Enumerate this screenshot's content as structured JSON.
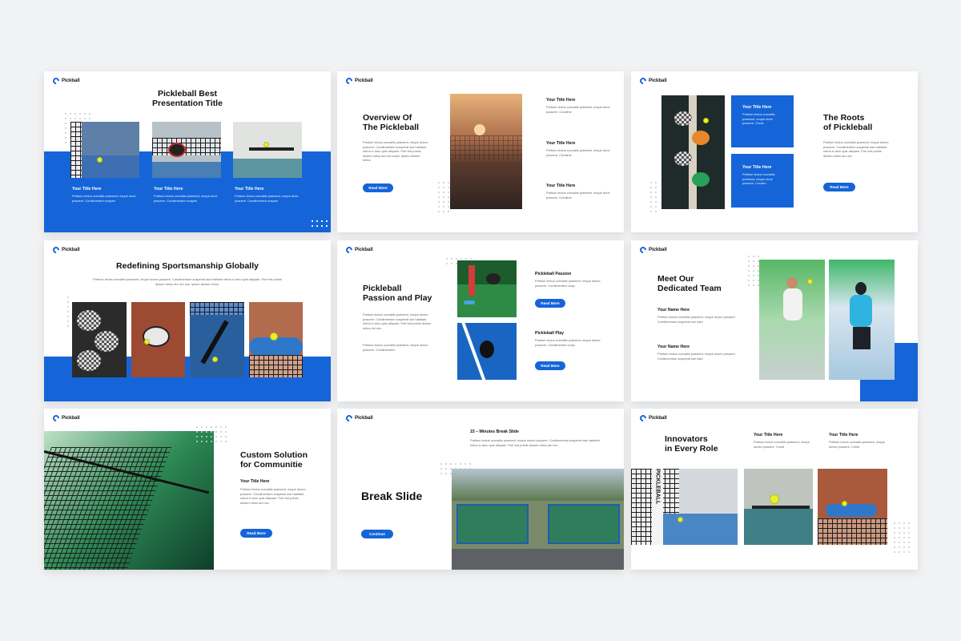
{
  "brand": "Pickball",
  "lorem": {
    "short": "Pretium lectus convallis praesent, neque donec posuere. Condimentum suspen",
    "medium": "Pretium lectus convallis praesent, neque donec posuere. Condimentum suspendi sse habitant netus in arcu quis aliquam.",
    "long": "Pretium lectus convallis praesent, neque donec posuere. Condimentum suspendi sse habitant netus in arcu quis aliquam. Port trot primis dictum netus dui nec sus. Ipsum dictum netus.",
    "tiny": "Pretium lectus convallis praesent, neque donec posuere. Condime"
  },
  "slide1": {
    "title_line1": "Pickleball Best",
    "title_line2": "Presentation Title",
    "items": [
      {
        "title": "Your Title Here",
        "text": "Pretium lectus convallis praesent, neque done posuere. Condimentum suspen"
      },
      {
        "title": "Your Title Here",
        "text": "Pretium lectus convallis praesent, neque done posuere. Condimentum suspen"
      },
      {
        "title": "Your Title Here",
        "text": "Pretium lectus convallis praesent, neque done posuere. Condimentum suspen"
      }
    ]
  },
  "slide2": {
    "title_line1": "Overview Of",
    "title_line2": "The Pickleball",
    "body": "Pretium lectus convallis praesent, neque donec posuere. Condimentum suspendi sse habitant netus in arcu quis aliquam. Port trot primis dictum netus dui nec susei, Ipsum dictum netus.",
    "button": "Read More",
    "items": [
      {
        "title": "Your Title Here",
        "text": "Pretium lectus convallis praesent, neque done posuere. Condime"
      },
      {
        "title": "Your Title Here",
        "text": "Pretium lectus convallis praesent, neque done posuere. Condime"
      },
      {
        "title": "Your Title Here",
        "text": "Pretium lectus convallis praesent, neque done posuere. Condime"
      }
    ]
  },
  "slide3": {
    "title_line1": "The Roots",
    "title_line2": "of Pickleball",
    "body": "Pretium lectus convallis praesent, neque donec posuere. Condimentum suspendi sse habitant netus in arcu quis aliquam. Port trot primis dictum netus dui nec.",
    "button": "Read More",
    "boxes": [
      {
        "title": "Your Title Here",
        "text": "Pretium lectus convallis praesent, neque done posuere. Condi"
      },
      {
        "title": "Your Title Here",
        "text": "Pretium lectus convallis praesent, neque done posuere. Condim"
      }
    ]
  },
  "slide4": {
    "title": "Redefining Sportsmanship Globally",
    "body": "Pretium lectus convallis praesent, neque donec posuere. Condimentum suspendi sse habitant netus in arcu quis aliquam. Port trot primis dictum netus dui nec sus. Ipsum dictum netus."
  },
  "slide5": {
    "title_line1": "Pickleball",
    "title_line2": "Passion and Play",
    "body1": "Pretium lectus convallis praesent, neque donec posuere. Condimentum suspendi sse habitant netus in arcu quis aliquam. Port trot primis dictum netus dui nec.",
    "body2": "Pretium lectus convallis praesent, neque donec posuere. Condimentum",
    "items": [
      {
        "title": "Pickleball Passion",
        "text": "Pretium lectus convallis praesent, neque donec posuere. Condimentum susp",
        "button": "Read More"
      },
      {
        "title": "Pickleball Play",
        "text": "Pretium lectus convallis praesent, neque donec posuere. Condimentum susp",
        "button": "Read More"
      }
    ]
  },
  "slide6": {
    "title_line1": "Meet Our",
    "title_line2": "Dedicated Team",
    "items": [
      {
        "title": "Your Name Here",
        "text": "Pretium lectus convallis praesent, neque donec posuere. Condimentum suspendi sse habi"
      },
      {
        "title": "Your Name Here",
        "text": "Pretium lectus convallis praesent, neque donec posuere. Condimentum suspendi sse habi"
      }
    ]
  },
  "slide7": {
    "title_line1": "Custom Solution",
    "title_line2": "for Communitie",
    "subtitle": "Your Title Here",
    "body": "Pretium lectus convallis praesent, neque donec posuere. Condimentum suspendi sse habitant netus in arcu quis aliquam. Port trot primis dictum netus dui nec.",
    "button": "Read More"
  },
  "slide8": {
    "subtitle": "15 – Minutes Break Slide",
    "body": "Pretium lectus convallis praesent, neque donec posuere. Condimentum suspendi sse habitant netus in arcu quis aliquam. Port trot primis dictum netus dui nec.",
    "title": "Break Slide",
    "button": "Continue"
  },
  "slide9": {
    "title_line1": "Innovators",
    "title_line2": "in Every Role",
    "items": [
      {
        "title": "Your Title Here",
        "text": "Pretium lectus convallis praesent, neque donec posuere. Condi"
      },
      {
        "title": "Your Title Here",
        "text": "Pretium lectus convallis praesent, neque donec posuere. Condi"
      }
    ],
    "photo_text": "PICKLEBALL"
  },
  "colors": {
    "accent": "#1565d8",
    "background": "#f1f2f4",
    "ball": "#e7f02a"
  }
}
